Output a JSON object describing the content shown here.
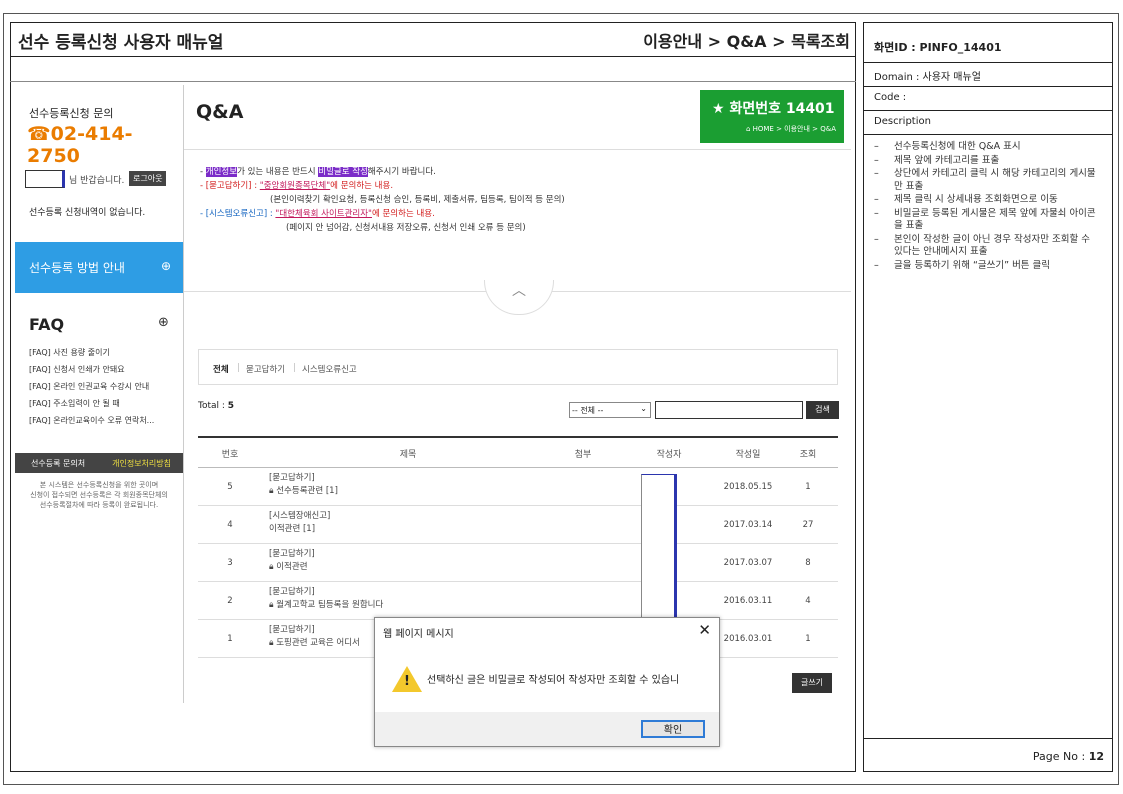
{
  "manual": {
    "title": "선수 등록신청 사용자 매뉴얼",
    "breadcrumb": "이용안내 > Q&A > 목록조회"
  },
  "right_panel": {
    "screen_id": "화면ID : PINFO_14401",
    "domain": "Domain : 사용자 매뉴얼",
    "code": "Code :",
    "description_label": "Description",
    "description": [
      "선수등록신청에 대한 Q&A 표시",
      "제목 앞에 카테고리를 표출",
      "상단에서 카테고리 클릭 시 해당 카테고리의 게시물만 표출",
      "제목 클릭 시 상세내용 조회화면으로 이동",
      "비밀글로 등록된 게시물은 제목 앞에 자물쇠 아이콘을 표출",
      "본인이 작성한 글이 아닌 경우 작성자만 조회할 수 있다는 안내메시지 표출",
      "글을 등록하기 위해 “글쓰기” 버튼 클릭"
    ],
    "page_no_label": "Page No :",
    "page_no": "12"
  },
  "sidebar": {
    "inquiry_label": "선수등록신청 문의",
    "phone": "02-414-2750",
    "welcome_text": "님 반갑습니다.",
    "logout_label": "로그아웃",
    "no_registration": "선수등록 신청내역이 없습니다.",
    "guide_label": "선수등록 방법 안내",
    "faq_title": "FAQ",
    "faq_items": [
      "[FAQ] 사진 용량 줄이기",
      "[FAQ] 신청서 인쇄가 안돼요",
      "[FAQ] 온라인 인권교육 수강시 안내",
      "[FAQ] 주소입력이 안 될 때",
      "[FAQ] 온라인교육이수 오류 연락처..."
    ],
    "footer_left": "선수등록 문의처",
    "footer_right": "개인정보처리방침",
    "footer_note": [
      "본 시스템은 선수등록신청을 위한 곳이며",
      "신청이 접수되면 선수등록은 각 회원종목단체의",
      "선수등록절차에 따라 등록이 완료됩니다."
    ]
  },
  "main": {
    "page_title": "Q&A",
    "screen_number": "화면번호 14401",
    "location": "HOME > 이용안내 > Q&A",
    "notes": {
      "line1_pre": "- ",
      "line1_hl1": "개인정보",
      "line1_mid": "가 있는 내용은 반드시 ",
      "line1_hl2": "비밀글로 작성",
      "line1_post": "해주시기 바랍니다.",
      "line2_cat": "- [묻고답하기] : ",
      "line2_target": "\"중앙회원종목단체\"",
      "line2_post": "에 문의하는 내용.",
      "line3": "(본인이력찾기 확인요청, 등록신청 승인, 등록비, 제출서류, 팀등록, 팀이적 등 문의)",
      "line4_cat": "- [시스템오류신고] : ",
      "line4_target": "\"대한체육회 사이트관리자\"",
      "line4_post": "에 문의하는 내용.",
      "line5": "(페이지 안 넘어감, 신청서내용 저장오류, 신청서 인쇄 오류 등 문의)"
    },
    "tabs": [
      "전체",
      "묻고답하기",
      "시스템오류신고"
    ],
    "total_label": "Total : ",
    "total_count": "5",
    "select_value": "-- 전체 --",
    "search_button": "검색",
    "columns": [
      "번호",
      "제목",
      "첨부",
      "작성자",
      "작성일",
      "조회"
    ],
    "rows": [
      {
        "no": "5",
        "category": "[묻고답하기]",
        "title": "선수등록관련 [1]",
        "locked": true,
        "date": "2018.05.15",
        "views": "1"
      },
      {
        "no": "4",
        "category": "[시스템장애신고]",
        "title": "이적관련 [1]",
        "locked": false,
        "date": "2017.03.14",
        "views": "27"
      },
      {
        "no": "3",
        "category": "[묻고답하기]",
        "title": "이적관련",
        "locked": true,
        "date": "2017.03.07",
        "views": "8"
      },
      {
        "no": "2",
        "category": "[묻고답하기]",
        "title": "월계고학교 팀등록을 원합니다",
        "locked": true,
        "date": "2016.03.11",
        "views": "4"
      },
      {
        "no": "1",
        "category": "[묻고답하기]",
        "title": "도핑관련 교육은 어디서",
        "locked": true,
        "date": "2016.03.01",
        "views": "1"
      }
    ],
    "write_button": "글쓰기"
  },
  "dialog": {
    "title": "웹 페이지 메시지",
    "message": "선택하신 글은 비밀글로 작성되어 작성자만 조회할 수 있습니",
    "ok_label": "확인"
  },
  "colors": {
    "phone": "#ea7c00",
    "guide_bg": "#2e9de4",
    "green_box": "#1b9e32",
    "highlight": "#7b2cc8",
    "warning": "#f3c82c"
  }
}
